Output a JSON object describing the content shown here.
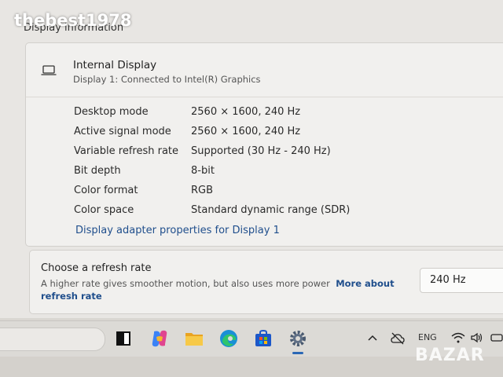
{
  "watermark": "thebest1978",
  "section_title": "Display information",
  "display": {
    "name": "Internal Display",
    "subtitle": "Display 1: Connected to Intel(R) Graphics",
    "properties": [
      {
        "label": "Desktop mode",
        "value": "2560 × 1600, 240 Hz"
      },
      {
        "label": "Active signal mode",
        "value": "2560 × 1600, 240 Hz"
      },
      {
        "label": "Variable refresh rate",
        "value": "Supported (30 Hz - 240 Hz)"
      },
      {
        "label": "Bit depth",
        "value": "8-bit"
      },
      {
        "label": "Color format",
        "value": "RGB"
      },
      {
        "label": "Color space",
        "value": "Standard dynamic range (SDR)"
      }
    ],
    "adapter_link": "Display adapter properties for Display 1"
  },
  "refresh": {
    "title": "Choose a refresh rate",
    "description": "A higher rate gives smoother motion, but also uses more power",
    "more_link": "More about refresh rate",
    "selected": "240 Hz"
  },
  "taskbar": {
    "apps": [
      "task-view-icon",
      "copilot-icon",
      "file-explorer-icon",
      "edge-icon",
      "store-icon",
      "settings-icon"
    ],
    "tray_language": "ENG"
  },
  "bazar_watermark": "BAZAR",
  "colors": {
    "link": "#1f4e8c",
    "accent": "#2b67b5"
  }
}
